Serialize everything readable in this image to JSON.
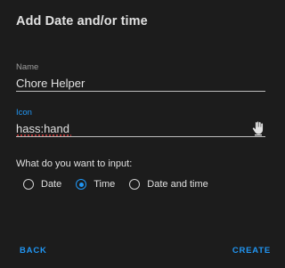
{
  "dialog": {
    "title": "Add Date and/or time"
  },
  "name_field": {
    "label": "Name",
    "value": "Chore Helper"
  },
  "icon_field": {
    "label": "Icon",
    "value": "hass:hand",
    "preview_icon": "hand-icon"
  },
  "input_type": {
    "question": "What do you want to input:",
    "options": [
      {
        "label": "Date",
        "selected": false
      },
      {
        "label": "Time",
        "selected": true
      },
      {
        "label": "Date and time",
        "selected": false
      }
    ]
  },
  "actions": {
    "back_label": "BACK",
    "create_label": "CREATE"
  },
  "colors": {
    "accent": "#2196f3",
    "background": "#1c1c1c",
    "text": "#e1e1e1"
  }
}
